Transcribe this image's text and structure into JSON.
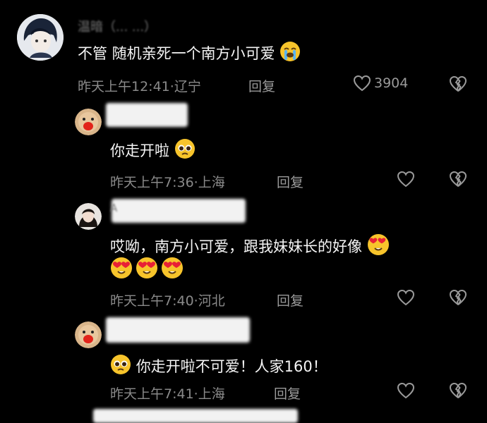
{
  "comments": [
    {
      "name": "温暗（... ...）",
      "text": "不管 随机亲死一个南方小可爱",
      "time": "昨天上午12:41",
      "location": "辽宁",
      "reply_label": "回复",
      "likes": "3904",
      "icons": [
        "avatar",
        "crying-emoji",
        "heart-icon",
        "broken-heart-icon"
      ]
    },
    {
      "text": "你走开啦",
      "time": "昨天上午7:36",
      "location": "上海",
      "reply_label": "回复",
      "icons": [
        "avatar",
        "pleading-emoji",
        "heart-icon",
        "broken-heart-icon"
      ]
    },
    {
      "name": "A",
      "text": "哎呦，南方小可爱，跟我妹妹长的好像",
      "time": "昨天上午7:40",
      "location": "河北",
      "reply_label": "回复",
      "icons": [
        "avatar",
        "heart-eyes-emoji",
        "heart-icon",
        "broken-heart-icon"
      ]
    },
    {
      "text": "你走开啦不可爱！人家160！",
      "time": "昨天上午7:41",
      "location": "上海",
      "reply_label": "回复",
      "icons": [
        "avatar",
        "pleading-emoji",
        "heart-icon",
        "broken-heart-icon"
      ]
    }
  ],
  "separator": "·",
  "colors": {
    "background": "#000000",
    "text": "#f5f5f5",
    "meta": "#8a8a8a",
    "emoji": "#f7c42b"
  }
}
